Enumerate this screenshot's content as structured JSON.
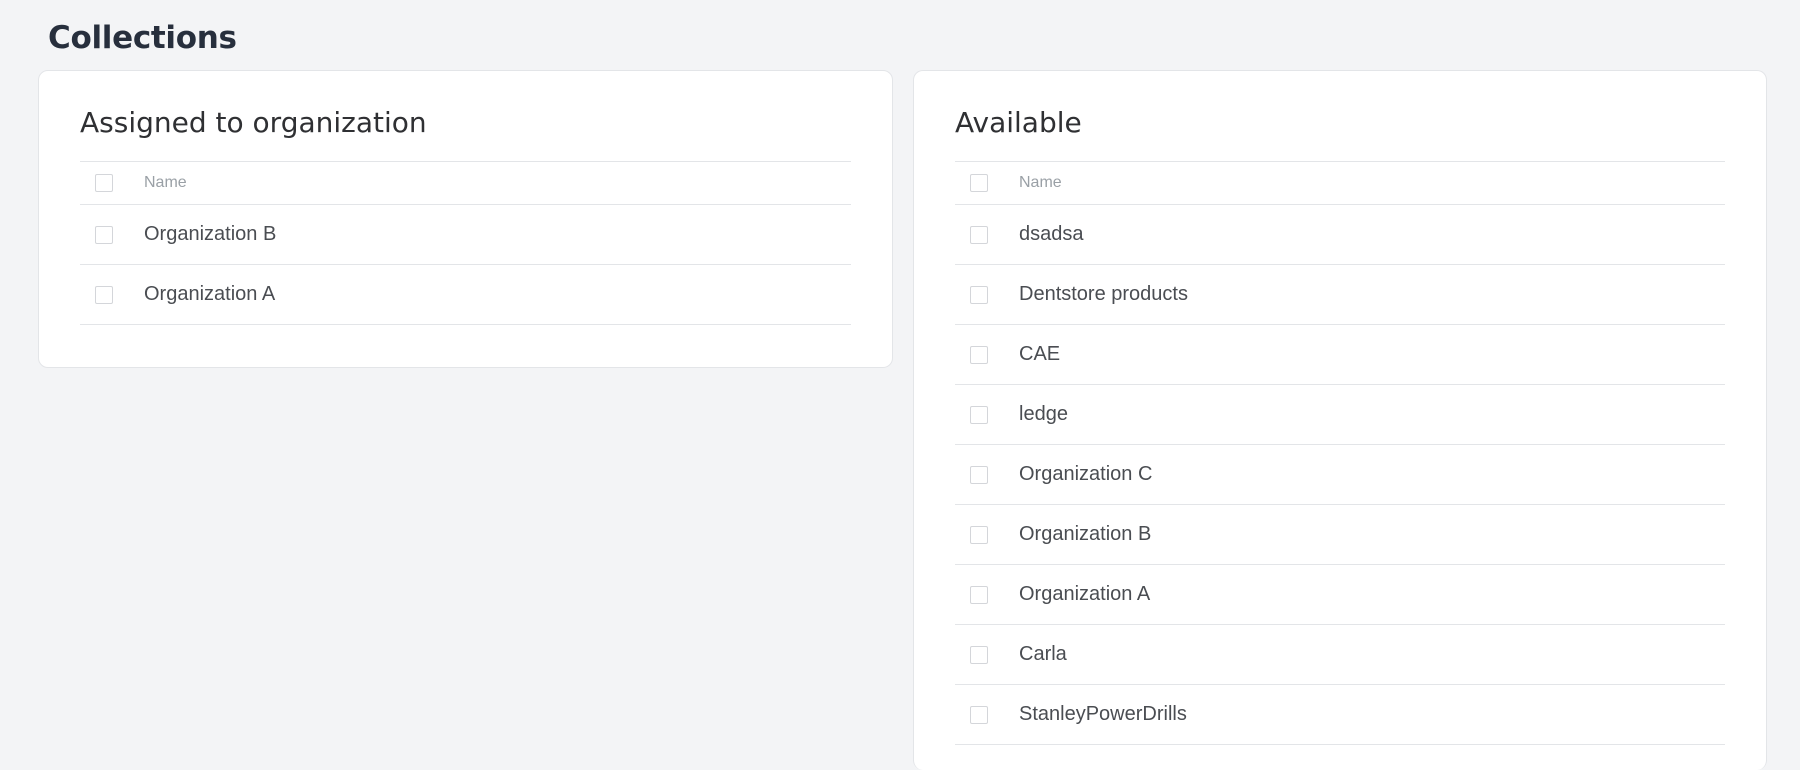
{
  "page": {
    "title": "Collections"
  },
  "assigned": {
    "title": "Assigned to organization",
    "column_name": "Name",
    "rows": [
      {
        "name": "Organization B"
      },
      {
        "name": "Organization A"
      }
    ]
  },
  "available": {
    "title": "Available",
    "column_name": "Name",
    "rows": [
      {
        "name": "dsadsa"
      },
      {
        "name": "Dentstore products"
      },
      {
        "name": "CAE"
      },
      {
        "name": "ledge"
      },
      {
        "name": "Organization C"
      },
      {
        "name": "Organization B"
      },
      {
        "name": "Organization A"
      },
      {
        "name": "Carla"
      },
      {
        "name": "StanleyPowerDrills"
      }
    ]
  },
  "colors": {
    "background": "#f3f4f6",
    "card": "#ffffff",
    "border": "#e3e5e8",
    "title_text": "#272f3d",
    "row_text": "#4a4d52",
    "header_text": "#9aa0a6"
  }
}
